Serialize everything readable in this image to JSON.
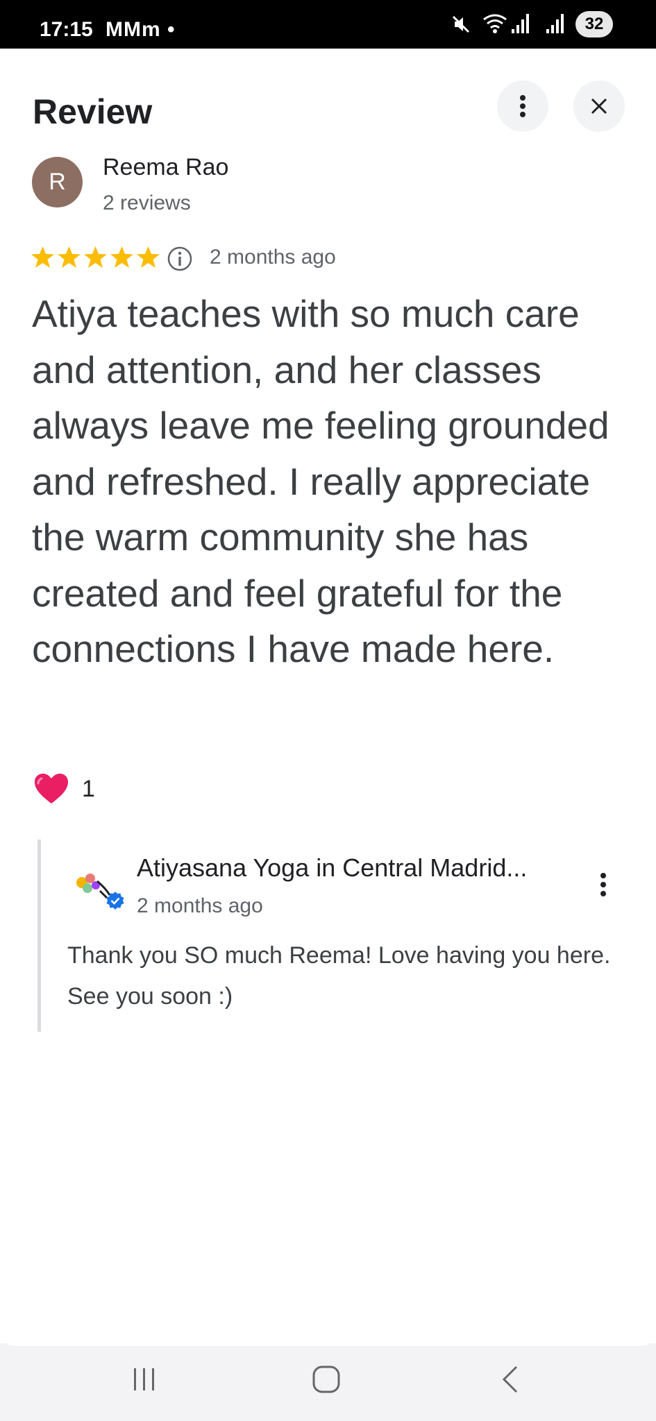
{
  "status_bar": {
    "time": "17:15",
    "notifications": "MMm •",
    "battery": "32"
  },
  "header": {
    "title": "Review"
  },
  "reviewer": {
    "initial": "R",
    "name": "Reema Rao",
    "reviews_count": "2 reviews",
    "avatar_color": "#8d6e63"
  },
  "review": {
    "rating": 5,
    "max_rating": 5,
    "date": "2 months ago",
    "text": "Atiya teaches with so much care and attention, and her classes always leave me feeling grounded and refreshed. I really appreciate the warm community she has created and feel grateful for the connections I have made here.",
    "reactions": {
      "icon": "heart-icon",
      "count": "1"
    }
  },
  "owner_reply": {
    "name": "Atiyasana Yoga in Central Madrid...",
    "date": "2 months ago",
    "text": "Thank you SO much Reema! Love having you here. See you soon :)",
    "verified_color": "#1a73e8"
  },
  "colors": {
    "star": "#fbbc04",
    "heart": "#e91e63",
    "text_primary": "#202124",
    "text_secondary": "#5f6368"
  },
  "nav_bar": {
    "icons": [
      "recents-icon",
      "home-icon",
      "back-icon"
    ]
  }
}
